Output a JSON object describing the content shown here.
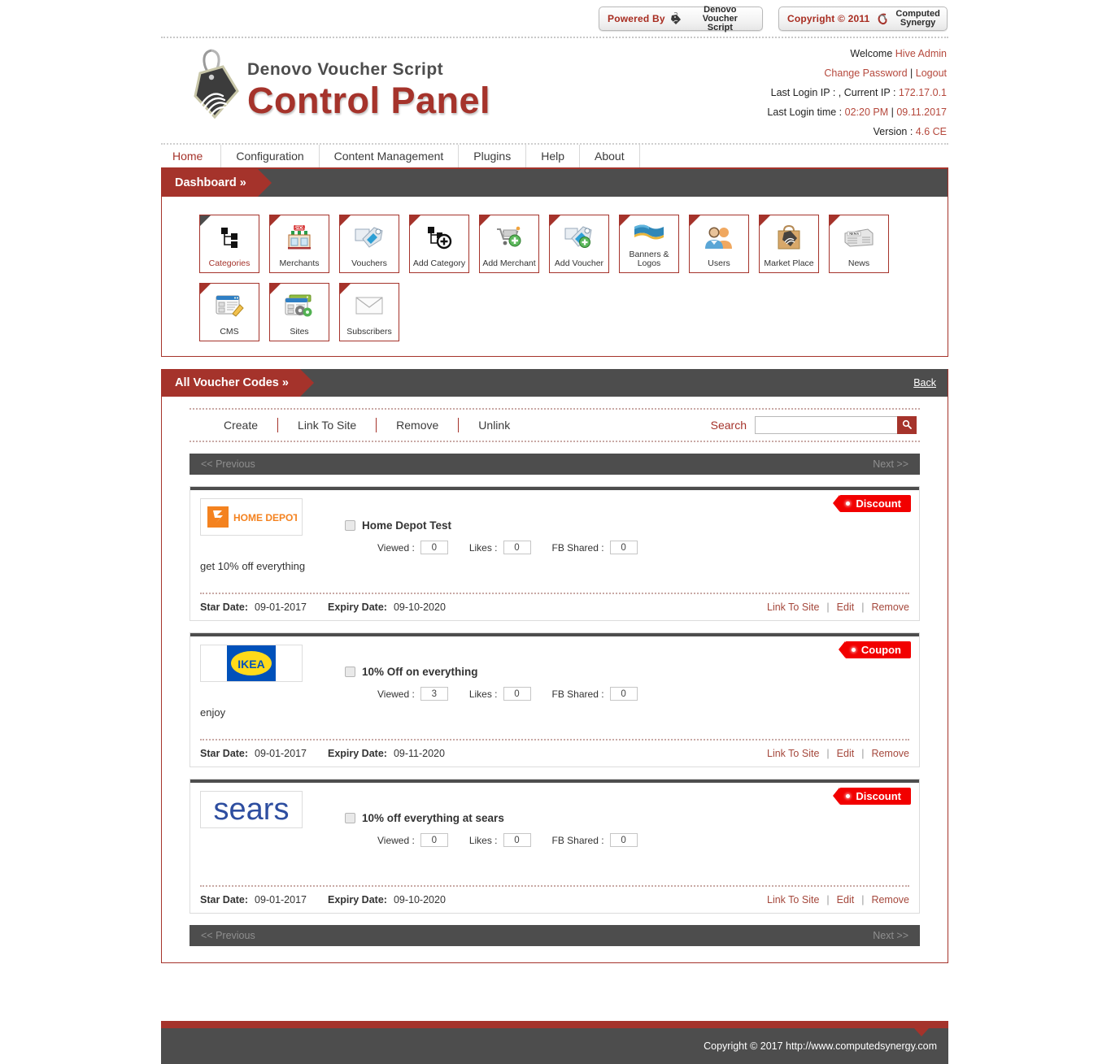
{
  "badges": {
    "powered_by_label": "Powered By",
    "powered_by_name_line1": "Denovo Voucher",
    "powered_by_name_line2": "Script",
    "copyright_label": "Copyright © 2011",
    "company_line1": "Computed",
    "company_line2": "Synergy"
  },
  "header": {
    "logo_top": "Denovo Voucher Script",
    "logo_main": "Control Panel",
    "welcome_label": "Welcome",
    "welcome_user": "Hive Admin",
    "change_password": "Change Password",
    "separator": "|",
    "logout": "Logout",
    "last_login_ip_label": "Last Login IP : ,  Current IP :",
    "current_ip": "172.17.0.1",
    "last_login_time_label": "Last Login time :",
    "last_login_time": "02:20 PM",
    "last_login_date": "09.11.2017",
    "version_label": "Version :",
    "version": "4.6 CE"
  },
  "nav": {
    "items": [
      {
        "label": "Home",
        "active": true
      },
      {
        "label": "Configuration",
        "active": false
      },
      {
        "label": "Content Management",
        "active": false
      },
      {
        "label": "Plugins",
        "active": false
      },
      {
        "label": "Help",
        "active": false
      },
      {
        "label": "About",
        "active": false
      }
    ]
  },
  "dashboard": {
    "title": "Dashboard »",
    "tiles": [
      {
        "label": "Categories",
        "icon": "sitemap-icon",
        "active": true
      },
      {
        "label": "Merchants",
        "icon": "shop-icon",
        "active": false
      },
      {
        "label": "Vouchers",
        "icon": "voucher-tag-icon",
        "active": false
      },
      {
        "label": "Add Category",
        "icon": "sitemap-plus-icon",
        "active": false
      },
      {
        "label": "Add Merchant",
        "icon": "cart-plus-icon",
        "active": false
      },
      {
        "label": "Add Voucher",
        "icon": "tag-plus-icon",
        "active": false
      },
      {
        "label": "Banners & Logos",
        "icon": "banner-icon",
        "active": false
      },
      {
        "label": "Users",
        "icon": "users-icon",
        "active": false
      },
      {
        "label": "Market Place",
        "icon": "shopping-bag-icon",
        "active": false
      },
      {
        "label": "News",
        "icon": "newspaper-icon",
        "active": false
      },
      {
        "label": "CMS",
        "icon": "cms-page-icon",
        "active": false
      },
      {
        "label": "Sites",
        "icon": "sites-gear-icon",
        "active": false
      },
      {
        "label": "Subscribers",
        "icon": "envelope-icon",
        "active": false
      }
    ]
  },
  "vouchers_panel": {
    "title": "All Voucher Codes »",
    "back_label": "Back",
    "toolbar": [
      "Create",
      "Link To Site",
      "Remove",
      "Unlink"
    ],
    "search_label": "Search",
    "search_value": "",
    "search_placeholder": "",
    "search_icon": "search-icon",
    "pager": {
      "previous": "<< Previous",
      "next": "Next >>"
    },
    "stat_labels": {
      "viewed": "Viewed :",
      "likes": "Likes :",
      "fb_shared": "FB Shared :"
    },
    "date_labels": {
      "start": "Star Date:",
      "expiry": "Expiry Date:"
    },
    "actions": {
      "link": "Link To Site",
      "edit": "Edit",
      "remove": "Remove",
      "separator": "|"
    },
    "items": [
      {
        "logo": "home-depot",
        "logo_alt": "HOME DEPOT",
        "title": "Home Depot Test",
        "badge": "Discount",
        "badge_color": "#f20000",
        "viewed": "0",
        "likes": "0",
        "fb_shared": "0",
        "description": "get 10% off everything",
        "start_date": "09-01-2017",
        "expiry_date": "09-10-2020",
        "checked": false
      },
      {
        "logo": "ikea",
        "logo_alt": "IKEA",
        "title": "10% Off on everything",
        "badge": "Coupon",
        "badge_color": "#f20000",
        "viewed": "3",
        "likes": "0",
        "fb_shared": "0",
        "description": "enjoy",
        "start_date": "09-01-2017",
        "expiry_date": "09-11-2020",
        "checked": false
      },
      {
        "logo": "sears",
        "logo_alt": "sears",
        "title": "10% off everything at sears",
        "badge": "Discount",
        "badge_color": "#f20000",
        "viewed": "0",
        "likes": "0",
        "fb_shared": "0",
        "description": "",
        "start_date": "09-01-2017",
        "expiry_date": "09-10-2020",
        "checked": false
      }
    ]
  },
  "footer": {
    "copyright": "Copyright © 2017 http://www.computedsynergy.com"
  },
  "colors": {
    "brand_red": "#a5332b",
    "dark_gray": "#4d4d4d",
    "badge_red": "#f20000",
    "link_red": "#a5483c"
  }
}
